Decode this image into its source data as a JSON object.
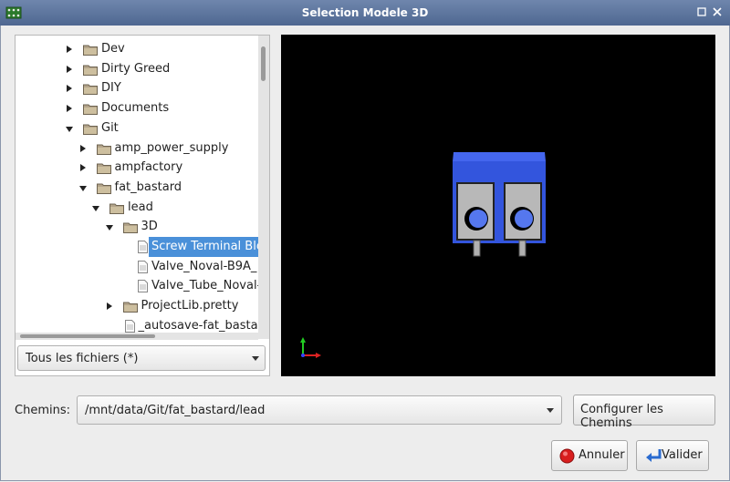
{
  "window": {
    "title": "Selection Modele 3D"
  },
  "tree": {
    "items": [
      {
        "label": "Dev",
        "type": "folder",
        "depth": 0,
        "expander": "collapsed"
      },
      {
        "label": "Dirty Greed",
        "type": "folder",
        "depth": 0,
        "expander": "collapsed"
      },
      {
        "label": "DIY",
        "type": "folder",
        "depth": 0,
        "expander": "collapsed"
      },
      {
        "label": "Documents",
        "type": "folder",
        "depth": 0,
        "expander": "collapsed"
      },
      {
        "label": "Git",
        "type": "folder",
        "depth": 0,
        "expander": "expanded"
      },
      {
        "label": "amp_power_supply",
        "type": "folder",
        "depth": 1,
        "expander": "collapsed"
      },
      {
        "label": "ampfactory",
        "type": "folder",
        "depth": 1,
        "expander": "collapsed"
      },
      {
        "label": "fat_bastard",
        "type": "folder",
        "depth": 1,
        "expander": "expanded"
      },
      {
        "label": "lead",
        "type": "folder",
        "depth": 2,
        "expander": "expanded"
      },
      {
        "label": "3D",
        "type": "folder",
        "depth": 3,
        "expander": "expanded"
      },
      {
        "label": "Screw Terminal Blo",
        "type": "file",
        "depth": 4,
        "expander": "none",
        "selected": true
      },
      {
        "label": "Valve_Noval-B9A_",
        "type": "file",
        "depth": 4,
        "expander": "none"
      },
      {
        "label": "Valve_Tube_Noval-",
        "type": "file",
        "depth": 4,
        "expander": "none"
      },
      {
        "label": "ProjectLib.pretty",
        "type": "folder",
        "depth": 3,
        "expander": "collapsed"
      },
      {
        "label": "_autosave-fat_basta",
        "type": "file",
        "depth": 3,
        "expander": "none"
      }
    ]
  },
  "filter": {
    "value": "Tous les fichiers (*)"
  },
  "paths": {
    "label": "Chemins:",
    "value": "/mnt/data/Git/fat_bastard/lead",
    "configure_button": "Configurer les Chemins"
  },
  "buttons": {
    "cancel": "Annuler",
    "ok": "Valider"
  },
  "colors": {
    "titlebar": "#5a739c",
    "selection": "#4a90d9",
    "model_body": "#3355dd",
    "model_contact": "#c0c0c0",
    "viewport_bg": "#000000"
  }
}
